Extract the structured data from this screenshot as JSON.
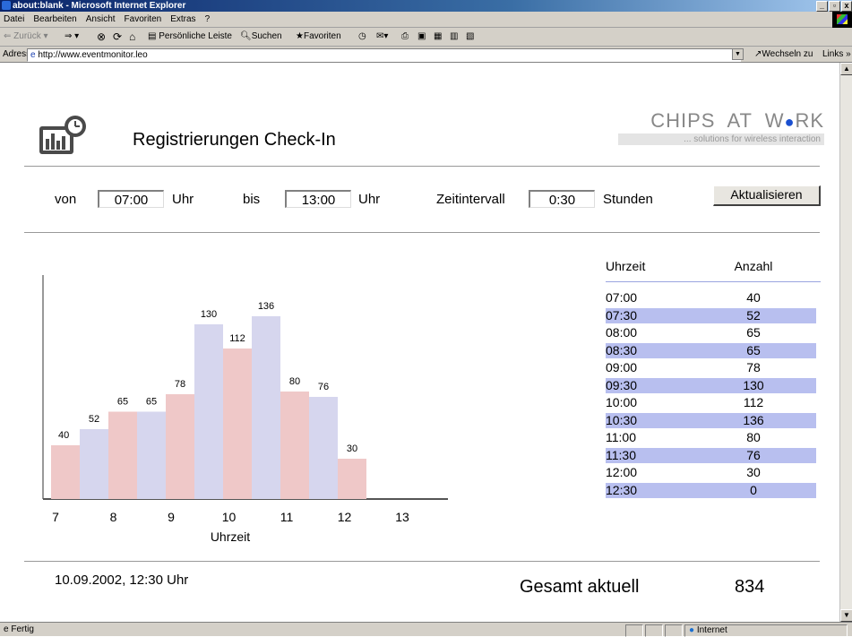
{
  "window": {
    "title": "about:blank - Microsoft Internet Explorer"
  },
  "menu": [
    "Datei",
    "Bearbeiten",
    "Ansicht",
    "Favoriten",
    "Extras",
    "?"
  ],
  "toolbar": {
    "back": "Zurück",
    "personal_bar": "Persönliche Leiste",
    "search": "Suchen",
    "favorites": "Favoriten"
  },
  "address": {
    "label": "Adresse",
    "url": "http://www.eventmonitor.leo",
    "go": "Wechseln zu",
    "links": "Links"
  },
  "status": {
    "left": "Fertig",
    "zone": "Internet"
  },
  "page": {
    "title": "Registrierungen Check-In",
    "brand": {
      "name_pre": "CHIPS  AT  W",
      "name_post": "RK",
      "tagline": "... solutions for wireless interaction"
    },
    "form": {
      "from_label": "von",
      "from_value": "07:00",
      "from_unit": "Uhr",
      "to_label": "bis",
      "to_value": "13:00",
      "to_unit": "Uhr",
      "interval_label": "Zeitintervall",
      "interval_value": "0:30",
      "interval_unit": "Stunden",
      "refresh_label": "Aktualisieren"
    },
    "table": {
      "col_time": "Uhrzeit",
      "col_count": "Anzahl",
      "rows": [
        {
          "time": "07:00",
          "count": "40"
        },
        {
          "time": "07:30",
          "count": "52"
        },
        {
          "time": "08:00",
          "count": "65"
        },
        {
          "time": "08:30",
          "count": "65"
        },
        {
          "time": "09:00",
          "count": "78"
        },
        {
          "time": "09:30",
          "count": "130"
        },
        {
          "time": "10:00",
          "count": "112"
        },
        {
          "time": "10:30",
          "count": "136"
        },
        {
          "time": "11:00",
          "count": "80"
        },
        {
          "time": "11:30",
          "count": "76"
        },
        {
          "time": "12:00",
          "count": "30"
        },
        {
          "time": "12:30",
          "count": "0"
        }
      ]
    },
    "footer": {
      "timestamp": "10.09.2002, 12:30 Uhr",
      "total_label": "Gesamt aktuell",
      "total_value": "834"
    }
  },
  "colors": {
    "bar_a": "#efc8c8",
    "bar_b": "#d6d6ee",
    "row_alt": "#b8bfef"
  },
  "chart_data": {
    "type": "bar",
    "xlabel": "Uhrzeit",
    "ylabel": "",
    "x_ticks": [
      "7",
      "8",
      "9",
      "10",
      "11",
      "12",
      "13"
    ],
    "categories": [
      "07:00",
      "07:30",
      "08:00",
      "08:30",
      "09:00",
      "09:30",
      "10:00",
      "10:30",
      "11:00",
      "11:30",
      "12:00",
      "12:30"
    ],
    "values": [
      40,
      52,
      65,
      65,
      78,
      130,
      112,
      136,
      80,
      76,
      30,
      0
    ],
    "ylim": [
      0,
      150
    ],
    "grid": false
  }
}
